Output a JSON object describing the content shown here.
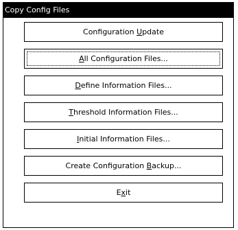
{
  "window": {
    "title": "Copy Config Files"
  },
  "buttons": [
    {
      "name": "configuration-update-button",
      "pre": "Configuration ",
      "mnemonic": "U",
      "post": "pdate",
      "focused": false
    },
    {
      "name": "all-configuration-files-button",
      "pre": "",
      "mnemonic": "A",
      "post": "ll Configuration Files...",
      "focused": true
    },
    {
      "name": "define-information-files-button",
      "pre": "",
      "mnemonic": "D",
      "post": "efine Information Files...",
      "focused": false
    },
    {
      "name": "threshold-information-files-button",
      "pre": "",
      "mnemonic": "T",
      "post": "hreshold Information Files...",
      "focused": false
    },
    {
      "name": "initial-information-files-button",
      "pre": "",
      "mnemonic": "I",
      "post": "nitial Information Files...",
      "focused": false
    },
    {
      "name": "create-configuration-backup-button",
      "pre": "Create Configuration ",
      "mnemonic": "B",
      "post": "ackup...",
      "focused": false
    },
    {
      "name": "exit-button",
      "pre": "E",
      "mnemonic": "x",
      "post": "it",
      "focused": false
    }
  ]
}
